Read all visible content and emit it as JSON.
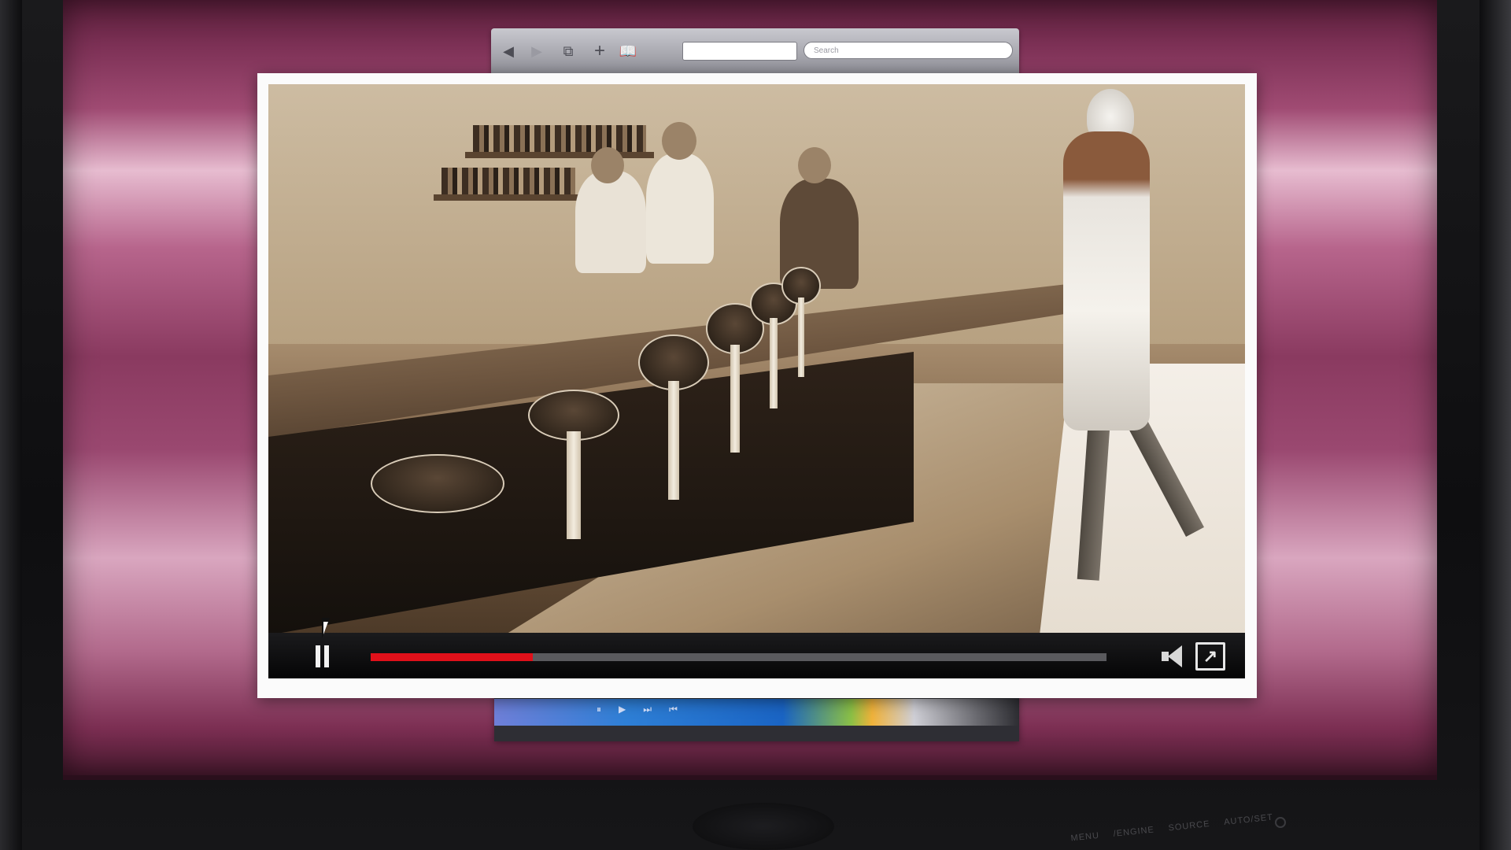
{
  "browser_toolbar": {
    "back_icon": "◀",
    "forward_icon": "▶",
    "tabs_icon": "⧉",
    "add_icon": "+",
    "bookmarks_icon": "📖",
    "search_placeholder": "Search"
  },
  "video_player": {
    "progress": 0.22,
    "playing": true,
    "fullscreen_glyph": "↗"
  },
  "lower_window": {
    "controls": [
      "⏸",
      "▶",
      "⏭",
      "⏮"
    ]
  },
  "monitor": {
    "labels": [
      "MENU",
      "/ENGINE",
      "SOURCE",
      "AUTO/SET"
    ]
  },
  "colors": {
    "accent": "#e0101a",
    "screen": "#a04b73"
  }
}
